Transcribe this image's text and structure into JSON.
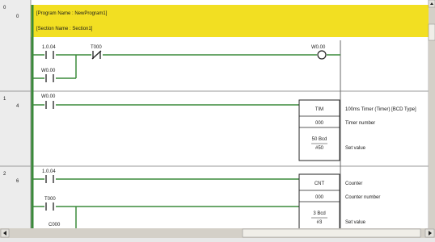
{
  "header": {
    "program_name": "[Program Name : NewProgram1]",
    "section_name": "[Section Name : Section1]"
  },
  "rungs": [
    {
      "row": "0",
      "step": "0",
      "contacts": [
        {
          "address": "1.0.04",
          "type": "NO"
        },
        {
          "address": "T000",
          "type": "NC"
        },
        {
          "address": "W0.00",
          "type": "NO",
          "branch": true
        }
      ],
      "output": {
        "address": "W0.00",
        "type": "coil"
      }
    },
    {
      "row": "1",
      "step": "4",
      "contacts": [
        {
          "address": "W0.00",
          "type": "NO"
        }
      ],
      "instruction": {
        "mnemonic": "TIM",
        "operands": [
          "000",
          "50 Bcd",
          "#50"
        ]
      },
      "comments": [
        "100ms Timer (Timer) [BCD Type]",
        "Timer number",
        "Set value"
      ]
    },
    {
      "row": "2",
      "step": "6",
      "contacts": [
        {
          "address": "1.0.04",
          "type": "NO"
        },
        {
          "address": "T000",
          "type": "NO"
        },
        {
          "address": "C000",
          "type": "NO"
        }
      ],
      "instruction": {
        "mnemonic": "CNT",
        "operands": [
          "000",
          "3 Bcd",
          "#3"
        ]
      },
      "comments": [
        "Counter",
        "Counter number",
        "Set value"
      ]
    }
  ],
  "colors": {
    "header_band": "#f2df22",
    "power_rail": "#3a8a3a",
    "row_band": "#ececec",
    "scrollbar": "#d4d0c8"
  },
  "icons": {
    "scroll_left": "arrow-left-icon",
    "scroll_right": "arrow-right-icon",
    "scroll_up": "arrow-up-icon",
    "scroll_down": "arrow-down-icon"
  }
}
